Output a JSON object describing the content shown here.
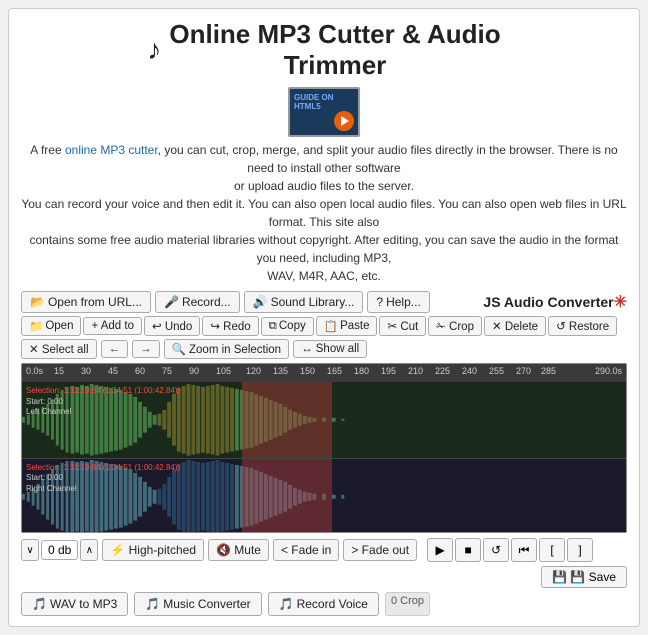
{
  "page": {
    "title_line1": "Online MP3 Cutter & Audio",
    "title_line2": "Trimmer"
  },
  "description": {
    "line1": "A free online MP3 cutter, you can cut, crop, merge, and split your audio files directly in the browser. There is no need to install other software",
    "line2": "or upload audio files to the server.",
    "line3": "You can record your voice and then edit it. You can also open local audio files. You can also open web files in URL format. This site also",
    "line4": "contains some free audio material libraries without copyright. After editing, you can save the audio in the format you need, including MP3,",
    "line5": "WAV, M4R, AAC, etc."
  },
  "toolbar": {
    "open_url": "Open from URL...",
    "record": "Record...",
    "sound_library": "Sound Library...",
    "help": "Help...",
    "js_audio_converter": "JS Audio Converter"
  },
  "edit_bar": {
    "open": "Open",
    "add_to": "+ Add to",
    "undo": "↩ Undo",
    "redo": "↪ Redo",
    "copy": "Copy",
    "paste": "Paste",
    "cut": "✂ Cut",
    "crop": "✁ Crop",
    "delete": "✕ Delete",
    "restore": "↺ Restore"
  },
  "select_bar": {
    "select_all": "✕ Select all",
    "arrow_left": "←",
    "arrow_right": "→",
    "zoom_in_selection": "🔍 Zoom in Selection",
    "show_all": "↔ Show all"
  },
  "timeline": {
    "start": "0.0s",
    "end": "290.0s",
    "labels": [
      "15",
      "30",
      "45",
      "60",
      "75",
      "90",
      "105",
      "120",
      "135",
      "150",
      "165",
      "180",
      "195",
      "210",
      "225",
      "240",
      "255",
      "270",
      "285"
    ]
  },
  "tracks": {
    "left": {
      "label_line1": "Selection: 1:11:19.84 (1:34:51 (1:00:42.84))",
      "label_line2": "Start: 0:00",
      "label_line3": "Left Channel"
    },
    "right": {
      "label_line1": "Selection: 1:11:19.84 (1:34:51 (1:00:42.84))",
      "label_line2": "Start: 0:00",
      "label_line3": "Right Channel"
    }
  },
  "bottom_controls": {
    "db_down": "∨",
    "db_value": "0 db",
    "db_up": "∧",
    "high_pitched": "⚡ High-pitched",
    "mute": "🔇 Mute",
    "fade_in": "< Fade in",
    "fade_out": "> Fade out",
    "play": "▶",
    "stop": "■",
    "loop": "↺",
    "skip_back": "⏮",
    "bracket_open": "[",
    "bracket_close": "]",
    "save": "💾 Save"
  },
  "bottom_nav": {
    "wav_to_mp3": "WAV to MP3",
    "music_converter": "Music Converter",
    "record_voice_icon": "🎵",
    "record_voice": "Record Voice",
    "crop_count": "0 Crop"
  }
}
